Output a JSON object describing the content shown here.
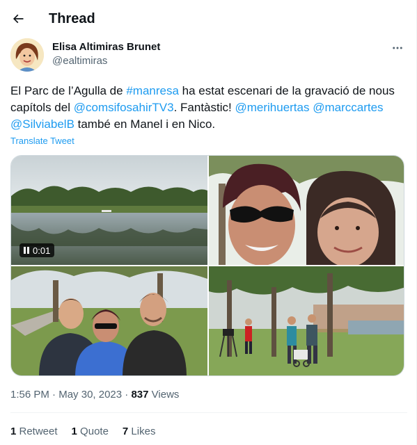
{
  "header": {
    "title": "Thread",
    "back_icon": "arrow-left-icon"
  },
  "author": {
    "name": "Elisa Altimiras Brunet",
    "handle": "@ealtimiras",
    "more_icon": "more-horizontal-icon"
  },
  "tweet": {
    "text_parts": {
      "p1": "El Parc de l’Agulla de ",
      "hashtag": "#manresa",
      "p2": " ha estat escenari de la gravació de nous capítols del ",
      "mention1": "@comsifosahirTV3",
      "p3": ". Fantàstic! ",
      "mention2": "@merihuertas",
      "sp1": " ",
      "mention3": "@marccartes",
      "sp2": " ",
      "mention4": "@SilviabelB",
      "p4": " també en Manel i en Nico."
    },
    "translate_label": "Translate Tweet",
    "video_time": "0:01"
  },
  "meta": {
    "time": "1:56 PM",
    "sep1": " · ",
    "date": "May 30, 2023",
    "sep2": " · ",
    "views_count": "837",
    "views_label": " Views"
  },
  "stats": {
    "retweets_count": "1",
    "retweets_label": " Retweet",
    "quotes_count": "1",
    "quotes_label": " Quote",
    "likes_count": "7",
    "likes_label": " Likes"
  },
  "colors": {
    "link": "#1d9bf0",
    "text": "#0f1419",
    "secondary": "#536471",
    "border": "#cfd9de"
  }
}
